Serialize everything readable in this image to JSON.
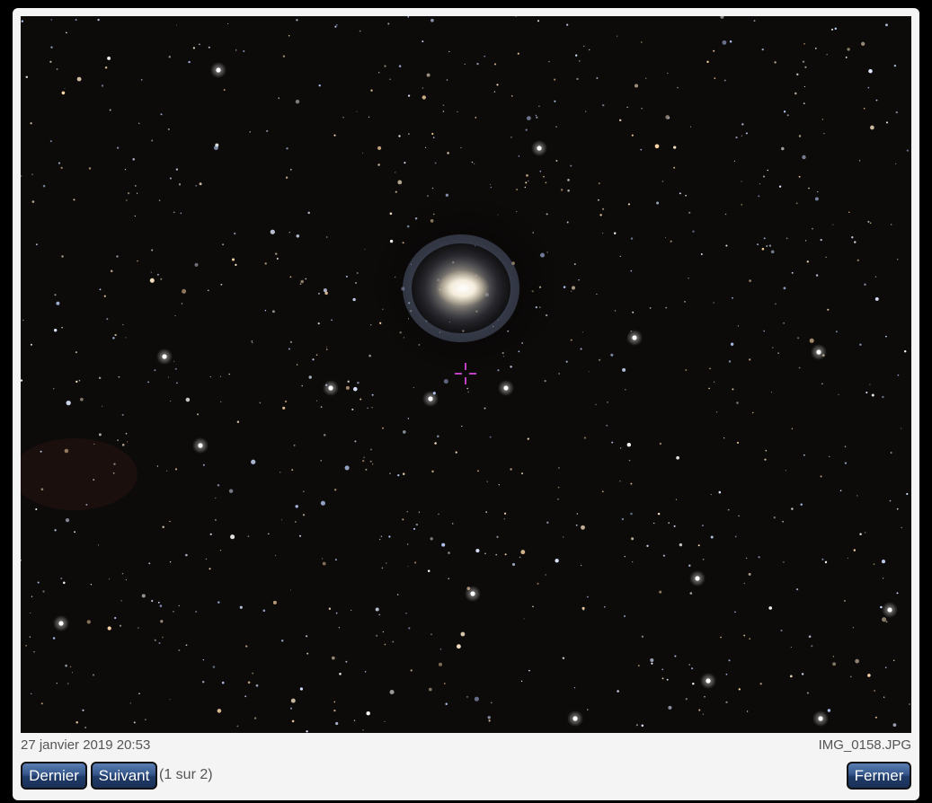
{
  "photo": {
    "alt": "Spiral galaxy star field",
    "colors": {
      "sky": "#0d0b0a",
      "marker": "#c040c0"
    }
  },
  "info": {
    "date": "27 janvier 2019 20:53",
    "filename": "IMG_0158.JPG"
  },
  "controls": {
    "last_label": "Dernier",
    "next_label": "Suivant",
    "counter": "(1 sur 2)",
    "close_label": "Fermer"
  }
}
